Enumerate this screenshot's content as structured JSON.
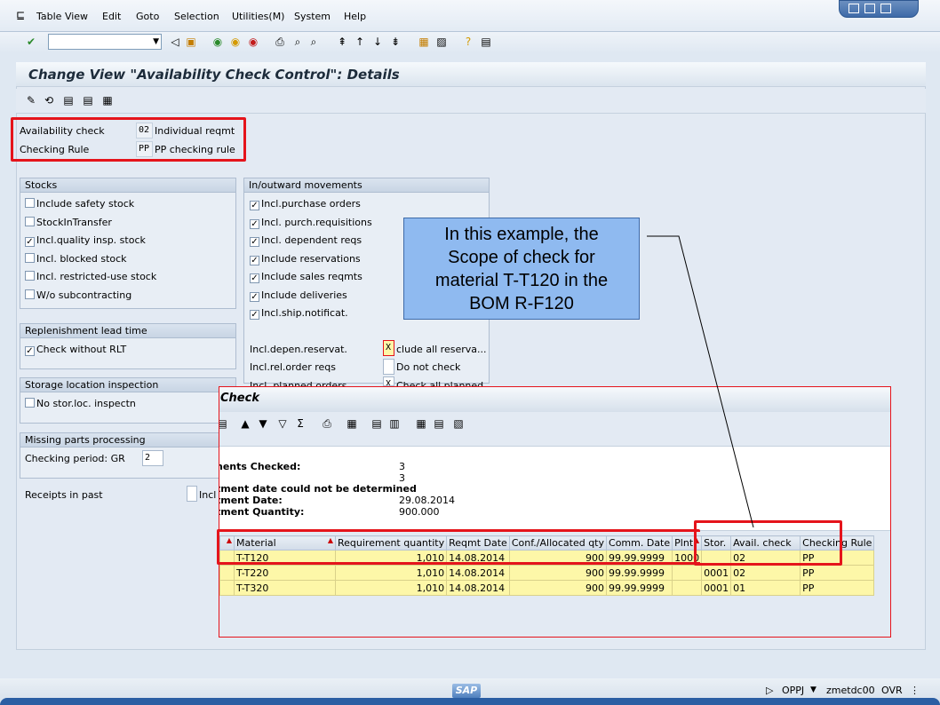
{
  "menu": {
    "items": [
      "Table View",
      "Edit",
      "Goto",
      "Selection",
      "Utilities(M)",
      "System",
      "Help"
    ]
  },
  "command_field": {
    "value": ""
  },
  "header": {
    "title": "Change View \"Availability Check Control\": Details"
  },
  "keys": {
    "availability_check": {
      "label": "Availability check",
      "code": "02",
      "text": "Individual reqmt"
    },
    "checking_rule": {
      "label": "Checking Rule",
      "code": "PP",
      "text": "PP checking rule"
    }
  },
  "stocks": {
    "title": "Stocks",
    "items": [
      {
        "label": "Include safety stock",
        "checked": ""
      },
      {
        "label": "StockInTransfer",
        "checked": ""
      },
      {
        "label": "Incl.quality insp. stock",
        "checked": "✓"
      },
      {
        "label": "Incl. blocked stock",
        "checked": ""
      },
      {
        "label": "Incl. restricted-use stock",
        "checked": ""
      },
      {
        "label": "W/o subcontracting",
        "checked": ""
      }
    ]
  },
  "replenishment": {
    "title": "Replenishment lead time",
    "items": [
      {
        "label": "Check without RLT",
        "checked": "✓"
      }
    ]
  },
  "storage": {
    "title": "Storage location inspection",
    "items": [
      {
        "label": "No stor.loc. inspectn",
        "checked": ""
      }
    ]
  },
  "missing_parts": {
    "title": "Missing parts processing",
    "checking_period_label": "Checking period: GR",
    "checking_period_value": "2"
  },
  "receipts": {
    "label": "Receipts in past",
    "checked": "",
    "option": "Incl"
  },
  "movements": {
    "title": "In/outward movements",
    "items": [
      {
        "label": "Incl.purchase orders",
        "checked": "✓"
      },
      {
        "label": "Incl. purch.requisitions",
        "checked": "✓"
      },
      {
        "label": "Incl. dependent reqs",
        "checked": "✓"
      },
      {
        "label": "Include reservations",
        "checked": "✓"
      },
      {
        "label": "Include sales reqmts",
        "checked": "✓"
      },
      {
        "label": "Include deliveries",
        "checked": "✓"
      },
      {
        "label": "Incl.ship.notificat.",
        "checked": "✓"
      }
    ],
    "depen_reservat": {
      "label": "Incl.depen.reservat.",
      "value": "X",
      "option": "clude all reserva..."
    },
    "rel_order": {
      "label": "Incl.rel.order reqs",
      "value": "",
      "option": "Do not check"
    },
    "planned_orders": {
      "label": "Incl. planned orders",
      "value": "X",
      "option": "Check all planned"
    }
  },
  "callout": {
    "lines": [
      "In this example, the",
      "Scope of check for",
      "material T-T120 in the",
      "BOM R-F120"
    ]
  },
  "popup": {
    "title": "y Check",
    "info": [
      {
        "label": "nents Checked:",
        "value": "3"
      },
      {
        "label": "",
        "value": "3"
      },
      {
        "label": "tment date could not be determined",
        "value": ""
      },
      {
        "label": "tment Date:",
        "value": "29.08.2014"
      },
      {
        "label": "tment Quantity:",
        "value": "900.000"
      }
    ],
    "columns": [
      "",
      "Material",
      "Requirement quantity",
      "Reqmt Date",
      "Conf./Allocated qty",
      "Comm. Date",
      "Plnt",
      "Stor.",
      "Avail. check",
      "Checking Rule"
    ],
    "rows": [
      [
        "",
        "T-T120",
        "1,010",
        "14.08.2014",
        "900",
        "99.99.9999",
        "1000",
        "",
        "02",
        "PP"
      ],
      [
        "",
        "T-T220",
        "1,010",
        "14.08.2014",
        "900",
        "99.99.9999",
        "",
        "0001",
        "02",
        "PP"
      ],
      [
        "",
        "T-T320",
        "1,010",
        "14.08.2014",
        "900",
        "99.99.9999",
        "",
        "0001",
        "01",
        "PP"
      ]
    ]
  },
  "status": {
    "logo": "SAP",
    "system": "OPPJ",
    "host": "zmetdc00",
    "mode": "OVR"
  },
  "colors": {
    "highlight_red": "#e5141b",
    "callout_blue": "#8fbaf0",
    "row_yellow": "#fdf7a8"
  }
}
